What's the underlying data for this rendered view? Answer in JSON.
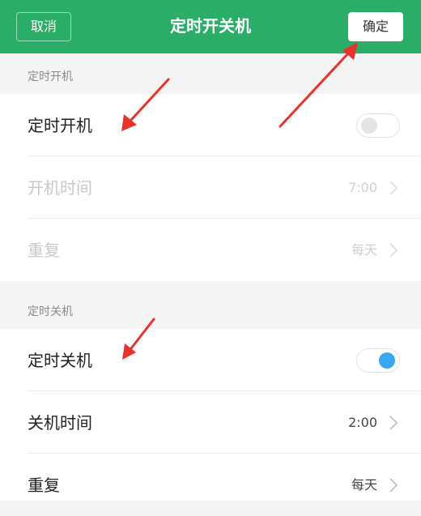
{
  "header": {
    "title": "定时开关机",
    "cancel_label": "取消",
    "confirm_label": "确定",
    "background_color": "#2aae67"
  },
  "power_on": {
    "section_label": "定时开机",
    "toggle_label": "定时开机",
    "toggle_state": "off",
    "time_label": "开机时间",
    "time_value": "7:00",
    "repeat_label": "重复",
    "repeat_value": "每天"
  },
  "power_off": {
    "section_label": "定时关机",
    "toggle_label": "定时关机",
    "toggle_state": "on",
    "time_label": "关机时间",
    "time_value": "2:00",
    "repeat_label": "重复",
    "repeat_value": "每天"
  },
  "annotations": {
    "arrow_color": "#e8322b",
    "arrow_count": 3
  },
  "icons": [
    "chevron-right-icon",
    "red-arrow-annotation"
  ]
}
